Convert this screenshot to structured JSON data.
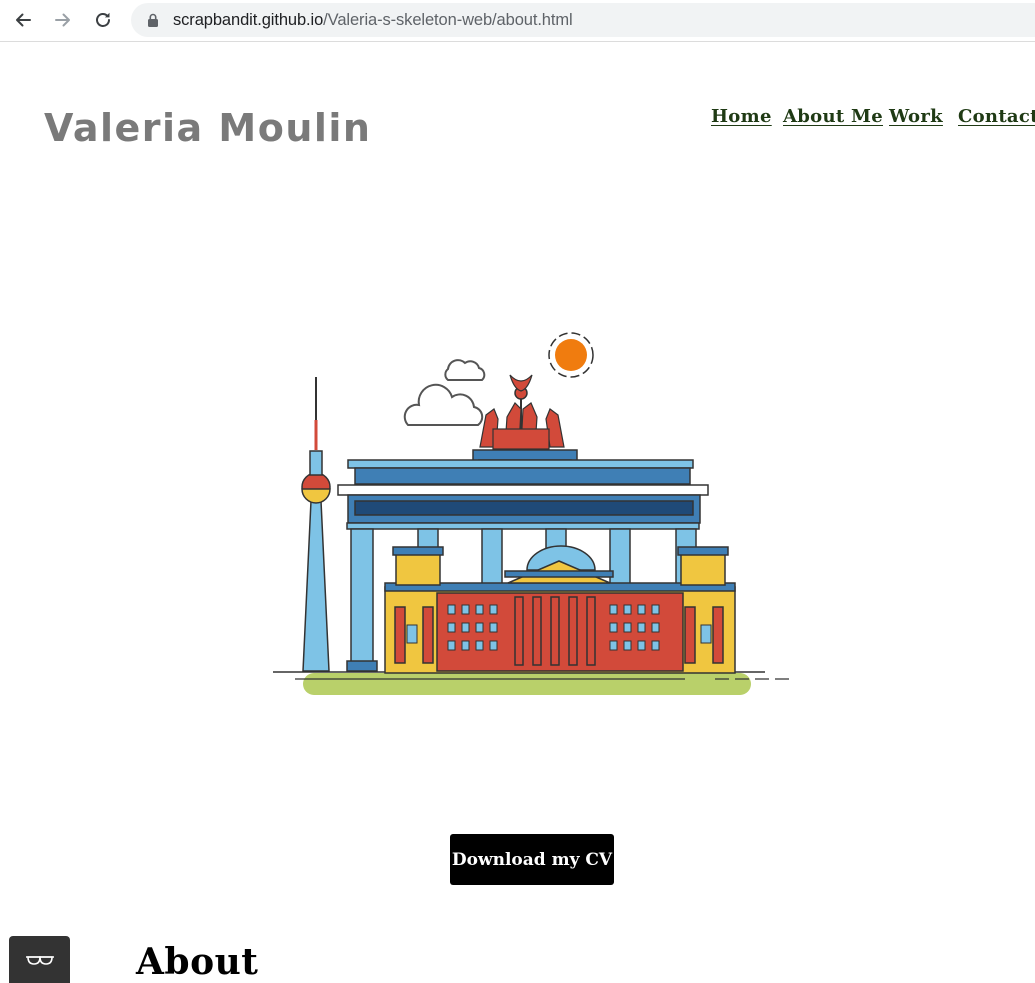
{
  "browser": {
    "url_host": "scrapbandit.github.io",
    "url_path": "/Valeria-s-skeleton-web/about.html",
    "icons": [
      "back-arrow-icon",
      "forward-arrow-icon",
      "reload-icon",
      "lock-icon"
    ]
  },
  "site": {
    "brand": "Valeria Moulin",
    "nav": {
      "home": "Home",
      "about": "About Me",
      "work": "Work",
      "contact": "Contact"
    },
    "nav_color": "#1f3a14",
    "brand_color": "#7a7a7a"
  },
  "hero": {
    "illustration": "berlin-landmarks-illustration"
  },
  "cv_button": {
    "label": "Download my CV"
  },
  "about": {
    "heading": "About"
  },
  "accessibility": {
    "icon": "glasses-icon"
  }
}
